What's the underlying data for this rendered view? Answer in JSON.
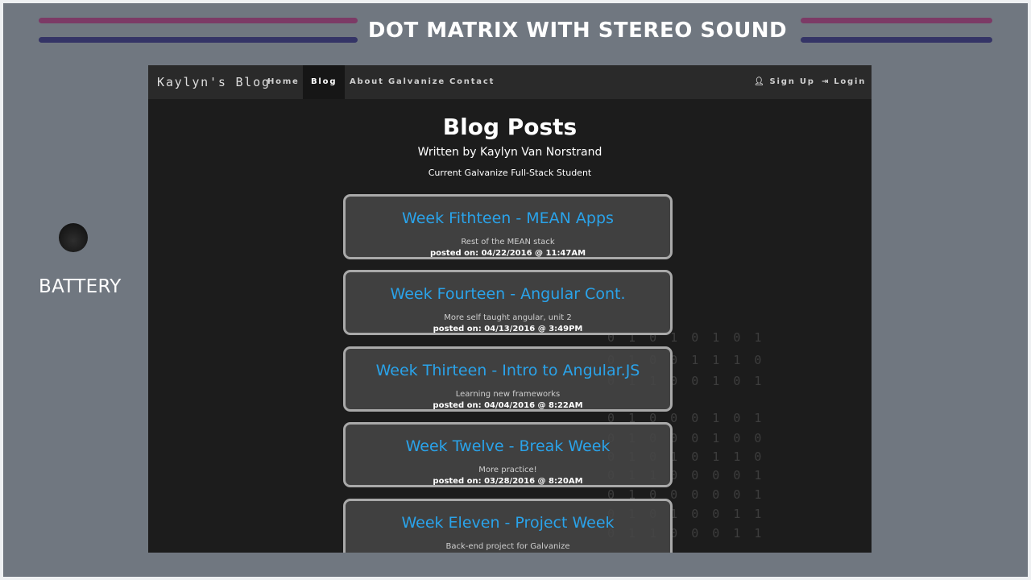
{
  "device": {
    "title": "DOT MATRIX WITH STEREO SOUND",
    "battery_label": "BATTERY",
    "colors": {
      "frame": "#707780",
      "stripe_pink": "#7c3a66",
      "stripe_blue": "#343466"
    }
  },
  "navbar": {
    "brand": "Kaylyn's Blog",
    "items": [
      {
        "label": "Home",
        "active": false
      },
      {
        "label": "Blog",
        "active": true
      },
      {
        "label": "About Galvanize",
        "active": false
      },
      {
        "label": "Contact",
        "active": false
      }
    ],
    "right": [
      {
        "label": "Sign Up",
        "icon": "user-icon"
      },
      {
        "label": "Login",
        "icon": "login-icon"
      }
    ]
  },
  "header": {
    "title": "Blog Posts",
    "subtitle": "Written by Kaylyn Van Norstrand",
    "subtitle2": "Current Galvanize Full-Stack Student"
  },
  "background_binary": [
    "0 1 0 1 0 1 0 1",
    "0 1 0 0 1 1 1 0",
    "0 1 1 0 0 1 0 1",
    "0 1 0 0 0 1 0 1",
    "0 1 0 0 0 1 0 0",
    "0 1 0 1 0 1 1 0",
    "0 1 1 0 0 0 0 1",
    "0 1 0 0 0 0 0 1",
    "0 1 0 1 0 0 1 1",
    "0 1 1 0 0 0 1 1"
  ],
  "posts": [
    {
      "title": "Week Fithteen - MEAN Apps",
      "description": "Rest of the MEAN stack",
      "posted": "posted on: 04/22/2016 @ 11:47AM"
    },
    {
      "title": "Week Fourteen - Angular Cont.",
      "description": "More self taught angular, unit 2",
      "posted": "posted on: 04/13/2016 @ 3:49PM"
    },
    {
      "title": "Week Thirteen - Intro to Angular.JS",
      "description": "Learning new frameworks",
      "posted": "posted on: 04/04/2016 @ 8:22AM"
    },
    {
      "title": "Week Twelve - Break Week",
      "description": "More practice!",
      "posted": "posted on: 03/28/2016 @ 8:20AM"
    },
    {
      "title": "Week Eleven - Project Week",
      "description": "Back-end project for Galvanize",
      "posted": ""
    }
  ]
}
